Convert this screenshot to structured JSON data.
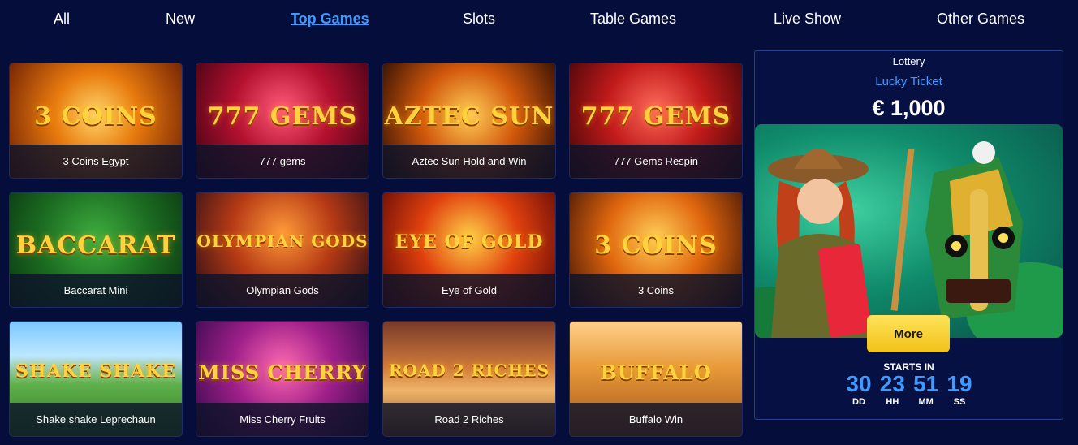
{
  "nav": {
    "items": [
      "All",
      "New",
      "Top Games",
      "Slots",
      "Table Games",
      "Live Show",
      "Other Games"
    ],
    "active": "Top Games"
  },
  "games": [
    {
      "name": "3 Coins Egypt",
      "art": "3 COINS",
      "icon": "coins-icon"
    },
    {
      "name": "777 gems",
      "art": "777 GEMS",
      "icon": "gems-icon"
    },
    {
      "name": "Aztec Sun Hold and Win",
      "art": "AZTEC SUN",
      "icon": "sun-icon"
    },
    {
      "name": "777 Gems Respin",
      "art": "777 GEMS",
      "icon": "gems-icon"
    },
    {
      "name": "Baccarat Mini",
      "art": "BACCARAT",
      "icon": "cards-icon"
    },
    {
      "name": "Olympian Gods",
      "art": "OLYMPIAN GODS",
      "icon": "gods-icon"
    },
    {
      "name": "Eye of Gold",
      "art": "EYE OF GOLD",
      "icon": "eye-icon"
    },
    {
      "name": "3 Coins",
      "art": "3 COINS",
      "icon": "coins-icon"
    },
    {
      "name": "Shake shake Leprechaun",
      "art": "SHAKE SHAKE",
      "icon": "leprechaun-icon"
    },
    {
      "name": "Miss Cherry Fruits",
      "art": "MISS CHERRY",
      "icon": "cherry-icon"
    },
    {
      "name": "Road 2 Riches",
      "art": "ROAD 2 RICHES",
      "icon": "road-icon"
    },
    {
      "name": "Buffalo Win",
      "art": "BUFFALO",
      "icon": "buffalo-icon"
    }
  ],
  "lottery": {
    "label": "Lottery",
    "name": "Lucky Ticket",
    "prize": "€ 1,000",
    "more_label": "More",
    "starts_label": "STARTS IN",
    "timer": [
      {
        "value": "30",
        "unit": "DD"
      },
      {
        "value": "23",
        "unit": "HH"
      },
      {
        "value": "51",
        "unit": "MM"
      },
      {
        "value": "19",
        "unit": "SS"
      }
    ]
  },
  "colors": {
    "background": "#050d3a",
    "accent": "#3d9bff",
    "button": "#f2c118"
  }
}
